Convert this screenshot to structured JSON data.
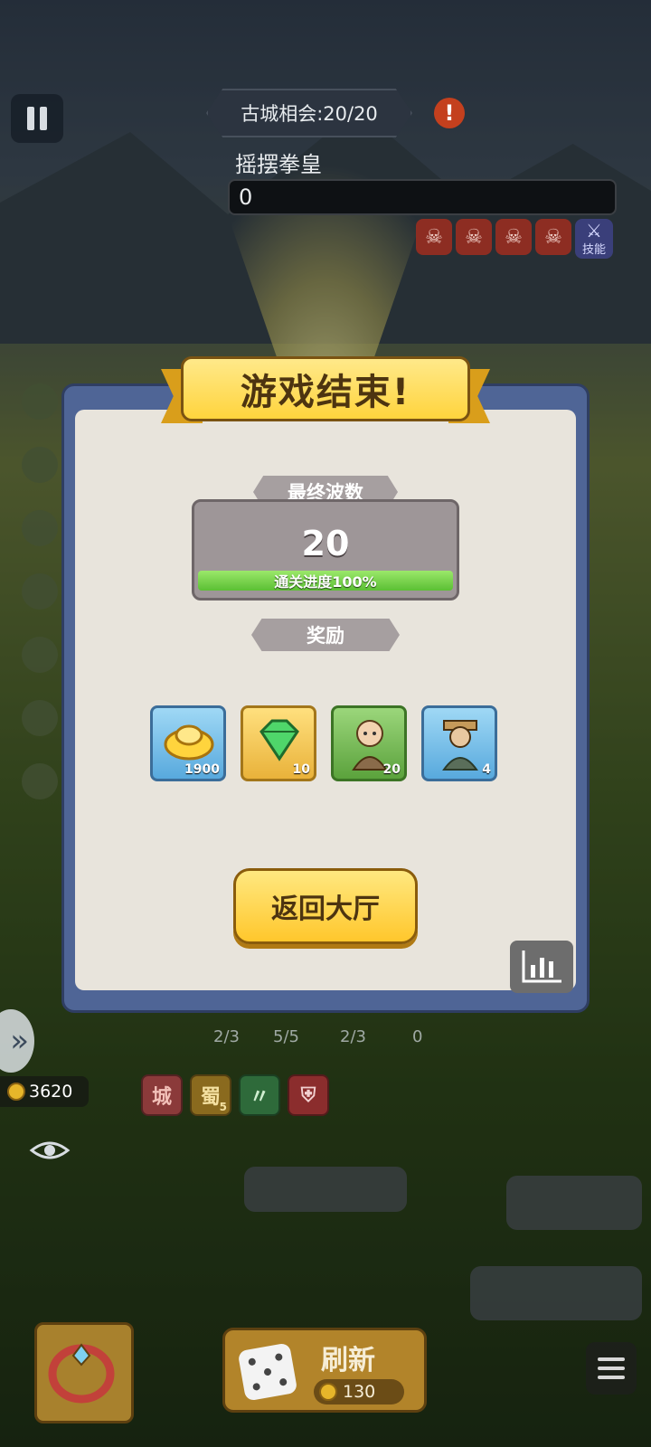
{
  "hud": {
    "level_banner": "古城相会:20/20",
    "boss_name": "摇摆拳皇",
    "boss_hp": "0",
    "skill_label": "技能",
    "gold_amount": "3620"
  },
  "modal": {
    "title": "游戏结束!",
    "wave_tag": "最终波数",
    "wave_number": "20",
    "progress_label": "通关进度100%",
    "progress_fraction": 1.0,
    "reward_tag": "奖励",
    "rewards": [
      {
        "icon": "gold-ingot-icon",
        "qty": "1900"
      },
      {
        "icon": "green-gem-icon",
        "qty": "10"
      },
      {
        "icon": "hero-portrait-icon",
        "qty": "20"
      },
      {
        "icon": "hero-portrait-icon",
        "qty": "4"
      }
    ],
    "return_button": "返回大厅"
  },
  "faction_counts": [
    "2/3",
    "5/5",
    "2/3",
    "0"
  ],
  "tiles": [
    "城",
    "蜀"
  ],
  "tile_badge": "5",
  "refresh": {
    "label": "刷新",
    "cost": "130"
  },
  "colors": {
    "accent_gold": "#ffd43d",
    "modal_frame": "#4f6596",
    "progress_green": "#5bbf34"
  }
}
